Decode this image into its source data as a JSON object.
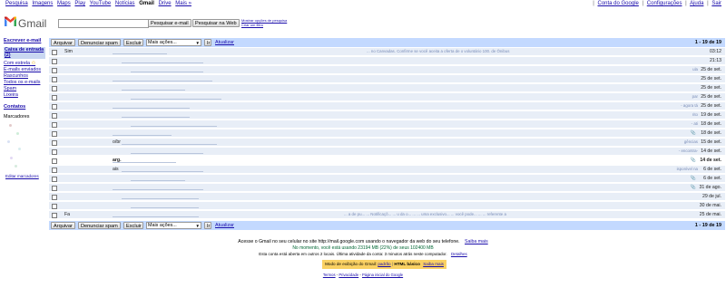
{
  "topbar": {
    "links": [
      "Pesquisa",
      "Imagens",
      "Maps",
      "Play",
      "YouTube",
      "Notícias",
      "Gmail",
      "Drive",
      "Mais »"
    ],
    "active": "Gmail",
    "account": "",
    "account_links": [
      "Conta do Google",
      "Configurações",
      "Ajuda",
      "Sair"
    ]
  },
  "logo_text": "Gmail",
  "search": {
    "value": "",
    "mail_button": "Pesquisar e-mail",
    "web_button": "Pesquisar na Web",
    "options_link": "Mostrar opções de pesquisa",
    "filter_link": "Criar um filtro"
  },
  "nav": {
    "compose": "Escrever e-mail",
    "inbox": "Caixa de entrada (2)",
    "items": [
      "Com estrela",
      "E-mails enviados",
      "Rascunhos",
      "Todos os e-mails",
      "Spam",
      "Lixeira"
    ],
    "contacts": "Contatos",
    "labels_title": "Marcadores",
    "labels_edit": "Editar marcadores"
  },
  "actions": {
    "archive": "Arquivar",
    "spam": "Denunciar spam",
    "delete": "Excluir",
    "more": "Mais ações...",
    "go": "Ir",
    "refresh": "Atualizar",
    "count": "1 - 19 de 19"
  },
  "rows": [
    {
      "sender": "Sim",
      "subject": "",
      "snippet": "... no Canvadas. Confirme se você aceita a oferta de o voluntário 100. de Ônibus",
      "date": "03:12",
      "unread": false,
      "clip": false
    },
    {
      "sender": "",
      "subject": "",
      "snippet": "",
      "date": "21:13",
      "unread": false,
      "clip": false
    },
    {
      "sender": "",
      "subject": "",
      "snippet": "ula",
      "date": "25 de set.",
      "unread": false,
      "clip": false
    },
    {
      "sender": "",
      "subject": "",
      "snippet": "",
      "date": "25 de set.",
      "unread": false,
      "clip": false
    },
    {
      "sender": "",
      "subject": "",
      "snippet": "",
      "date": "25 de set.",
      "unread": false,
      "clip": false
    },
    {
      "sender": "",
      "subject": "",
      "snippet": "par",
      "date": "25 de set.",
      "unread": false,
      "clip": false
    },
    {
      "sender": "",
      "subject": "",
      "snippet": "- agora tá",
      "date": "25 de set.",
      "unread": false,
      "clip": false
    },
    {
      "sender": "",
      "subject": "",
      "snippet": "rito",
      "date": "19 de set.",
      "unread": false,
      "clip": false
    },
    {
      "sender": "",
      "subject": "",
      "snippet": "- ati",
      "date": "18 de set.",
      "unread": false,
      "clip": false
    },
    {
      "sender": "",
      "subject": "",
      "snippet": "",
      "date": "18 de set.",
      "unread": false,
      "clip": true
    },
    {
      "sender": "",
      "subject": "o/br",
      "snippet": "gências",
      "date": "15 de set.",
      "unread": false,
      "clip": false
    },
    {
      "sender": "",
      "subject": "",
      "snippet": "- encontra-",
      "date": "14 de set.",
      "unread": false,
      "clip": false
    },
    {
      "sender": "",
      "subject": "arg.",
      "snippet": "",
      "date": "14 de set.",
      "unread": true,
      "clip": true
    },
    {
      "sender": "",
      "subject": "ais",
      "snippet": "isponível na",
      "date": "6 de set.",
      "unread": false,
      "clip": false
    },
    {
      "sender": "",
      "subject": "",
      "snippet": "",
      "date": "6 de set.",
      "unread": false,
      "clip": true
    },
    {
      "sender": "",
      "subject": "",
      "snippet": "",
      "date": "31 de ago.",
      "unread": false,
      "clip": true
    },
    {
      "sender": "",
      "subject": "",
      "snippet": "",
      "date": "29 de jul.",
      "unread": false,
      "clip": false
    },
    {
      "sender": "",
      "subject": "",
      "snippet": "",
      "date": "30 de mai.",
      "unread": false,
      "clip": false
    },
    {
      "sender": "Fa",
      "subject": "",
      "snippet": "... a de pu... ... Notificaçõ... ... u da o... ... ... uma exclusivo... ... você pode... ... ... referente a",
      "date": "25 de mai.",
      "unread": false,
      "clip": false
    }
  ],
  "footer": {
    "mobile": "Acesse o Gmail no seu celular no site http://mail.google.com usando o navegador da web do seu telefone.",
    "mobile_link": "Saiba mais",
    "storage": "No momento, você está usando 23194 MB (22%) de seus 102400 MB",
    "activity": "Esta conta está aberta em outros 2 locais.   Última atividade da conta: 3 minutos atrás neste computador.",
    "activity_link": "Detalhes",
    "mode_prefix": "Modo de exibição do Gmail:",
    "mode_standard": "padrão",
    "mode_basic": "HTML básico",
    "mode_link": "Saiba mais",
    "terms": "Termos",
    "privacy": "Privacidade",
    "google_home": "Página inicial do Google"
  },
  "colors": {
    "accent_bar": "#c3d9ff",
    "inbox_highlight": "#c9d7f1",
    "read_row": "#e8eef7",
    "mode_banner": "#fad163"
  }
}
